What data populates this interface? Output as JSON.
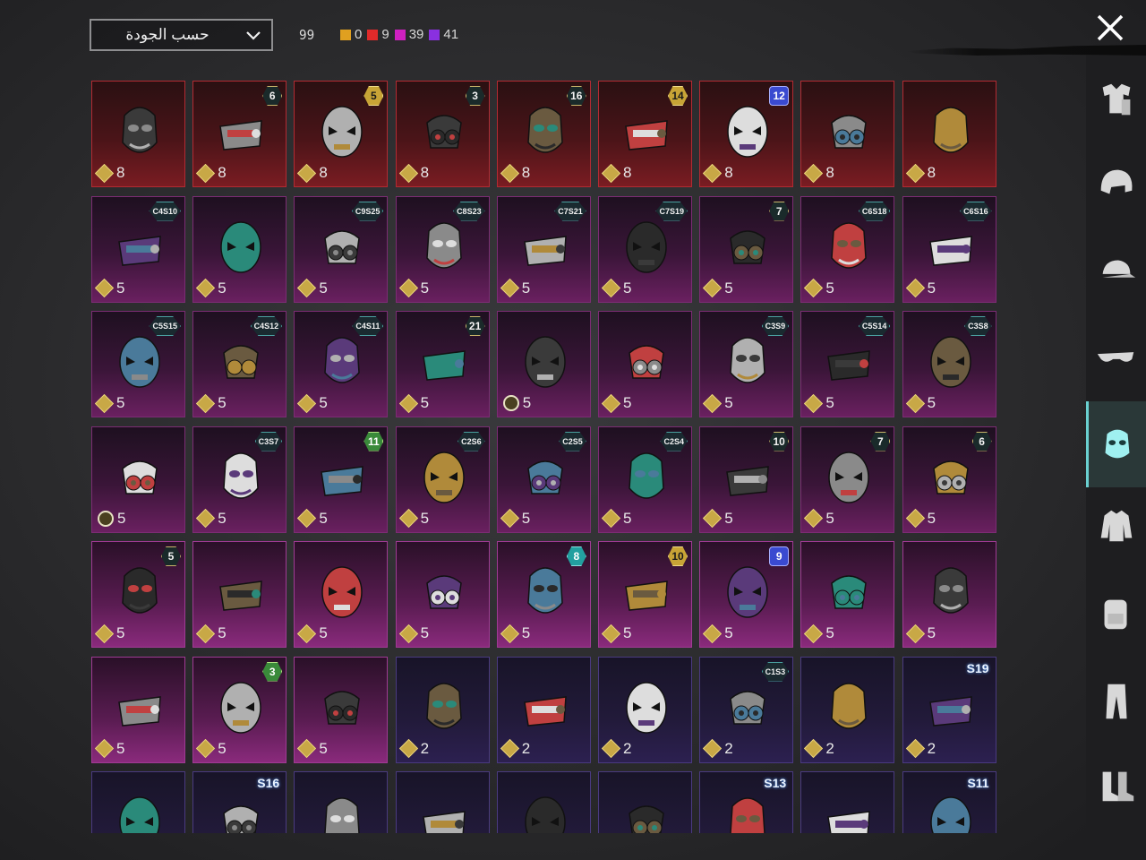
{
  "header": {
    "sort_label": "حسب الجودة",
    "total_count": "99",
    "quality_counts": [
      {
        "color": "#e0a020",
        "value": "0"
      },
      {
        "color": "#e02a2a",
        "value": "9"
      },
      {
        "color": "#d020c0",
        "value": "39"
      },
      {
        "color": "#8a30e0",
        "value": "41"
      }
    ],
    "close_icon": "close-icon"
  },
  "tiles": [
    {
      "rarity": "red",
      "count": "8",
      "badge": "",
      "badge_style": ""
    },
    {
      "rarity": "red",
      "count": "8",
      "badge": "6",
      "badge_style": ""
    },
    {
      "rarity": "red",
      "count": "8",
      "badge": "5",
      "badge_style": "gold"
    },
    {
      "rarity": "red",
      "count": "8",
      "badge": "3",
      "badge_style": ""
    },
    {
      "rarity": "red",
      "count": "8",
      "badge": "16",
      "badge_style": ""
    },
    {
      "rarity": "red",
      "count": "8",
      "badge": "14",
      "badge_style": "gold"
    },
    {
      "rarity": "red",
      "count": "8",
      "badge": "12",
      "badge_style": "blue-shield"
    },
    {
      "rarity": "red",
      "count": "8",
      "badge": "",
      "badge_style": ""
    },
    {
      "rarity": "red",
      "count": "8",
      "badge": "",
      "badge_style": ""
    },
    {
      "rarity": "pink",
      "count": "5",
      "badge": "C4S10",
      "badge_style": "hex-season"
    },
    {
      "rarity": "pink",
      "count": "5",
      "badge": "",
      "badge_style": ""
    },
    {
      "rarity": "pink",
      "count": "5",
      "badge": "C9S25",
      "badge_style": "hex-season"
    },
    {
      "rarity": "pink",
      "count": "5",
      "badge": "C8S23",
      "badge_style": "hex-season"
    },
    {
      "rarity": "pink",
      "count": "5",
      "badge": "C7S21",
      "badge_style": "hex-season"
    },
    {
      "rarity": "pink",
      "count": "5",
      "badge": "C7S19",
      "badge_style": "hex-season"
    },
    {
      "rarity": "pink",
      "count": "5",
      "badge": "7",
      "badge_style": ""
    },
    {
      "rarity": "pink",
      "count": "5",
      "badge": "C6S18",
      "badge_style": "hex-season"
    },
    {
      "rarity": "pink",
      "count": "5",
      "badge": "C6S16",
      "badge_style": "hex-season"
    },
    {
      "rarity": "pink",
      "count": "5",
      "badge": "C5S15",
      "badge_style": "hex-season"
    },
    {
      "rarity": "pink",
      "count": "5",
      "badge": "C4S12",
      "badge_style": "hex-season"
    },
    {
      "rarity": "pink",
      "count": "5",
      "badge": "C4S11",
      "badge_style": "hex-season"
    },
    {
      "rarity": "pink",
      "count": "5",
      "badge": "21",
      "badge_style": ""
    },
    {
      "rarity": "pink",
      "count": "5",
      "badge": "",
      "badge_style": "",
      "coin": "ring"
    },
    {
      "rarity": "pink",
      "count": "5",
      "badge": "",
      "badge_style": ""
    },
    {
      "rarity": "pink",
      "count": "5",
      "badge": "C3S9",
      "badge_style": "hex-season"
    },
    {
      "rarity": "pink",
      "count": "5",
      "badge": "C5S14",
      "badge_style": "hex-season"
    },
    {
      "rarity": "pink",
      "count": "5",
      "badge": "C3S8",
      "badge_style": "hex-season"
    },
    {
      "rarity": "pink",
      "count": "5",
      "badge": "",
      "badge_style": "",
      "coin": "ring"
    },
    {
      "rarity": "pink",
      "count": "5",
      "badge": "C3S7",
      "badge_style": "hex-season"
    },
    {
      "rarity": "pink",
      "count": "5",
      "badge": "11",
      "badge_style": "green"
    },
    {
      "rarity": "pink",
      "count": "5",
      "badge": "C2S6",
      "badge_style": "hex-season"
    },
    {
      "rarity": "pink",
      "count": "5",
      "badge": "C2S5",
      "badge_style": "hex-season"
    },
    {
      "rarity": "pink",
      "count": "5",
      "badge": "C2S4",
      "badge_style": "hex-season"
    },
    {
      "rarity": "pink",
      "count": "5",
      "badge": "10",
      "badge_style": ""
    },
    {
      "rarity": "pink",
      "count": "5",
      "badge": "7",
      "badge_style": ""
    },
    {
      "rarity": "pink",
      "count": "5",
      "badge": "6",
      "badge_style": ""
    },
    {
      "rarity": "pink bright",
      "count": "5",
      "badge": "5",
      "badge_style": ""
    },
    {
      "rarity": "pink bright",
      "count": "5",
      "badge": "",
      "badge_style": ""
    },
    {
      "rarity": "pink bright",
      "count": "5",
      "badge": "",
      "badge_style": ""
    },
    {
      "rarity": "pink bright",
      "count": "5",
      "badge": "",
      "badge_style": ""
    },
    {
      "rarity": "pink bright",
      "count": "5",
      "badge": "8",
      "badge_style": "teal"
    },
    {
      "rarity": "pink bright",
      "count": "5",
      "badge": "10",
      "badge_style": "gold"
    },
    {
      "rarity": "pink bright",
      "count": "5",
      "badge": "9",
      "badge_style": "blue-shield"
    },
    {
      "rarity": "pink bright",
      "count": "5",
      "badge": "",
      "badge_style": ""
    },
    {
      "rarity": "pink bright",
      "count": "5",
      "badge": "",
      "badge_style": ""
    },
    {
      "rarity": "pink bright",
      "count": "5",
      "badge": "",
      "badge_style": ""
    },
    {
      "rarity": "pink bright",
      "count": "5",
      "badge": "3",
      "badge_style": "green"
    },
    {
      "rarity": "pink bright",
      "count": "5",
      "badge": "",
      "badge_style": ""
    },
    {
      "rarity": "purple",
      "count": "2",
      "badge": "",
      "badge_style": ""
    },
    {
      "rarity": "purple",
      "count": "2",
      "badge": "",
      "badge_style": ""
    },
    {
      "rarity": "purple",
      "count": "2",
      "badge": "",
      "badge_style": ""
    },
    {
      "rarity": "purple",
      "count": "2",
      "badge": "C1S3",
      "badge_style": "hex-season"
    },
    {
      "rarity": "purple",
      "count": "2",
      "badge": "",
      "badge_style": ""
    },
    {
      "rarity": "purple",
      "count": "2",
      "badge": "S19",
      "badge_style": "ribbon"
    },
    {
      "rarity": "purple",
      "count": "",
      "badge": "",
      "badge_style": ""
    },
    {
      "rarity": "purple",
      "count": "",
      "badge": "S16",
      "badge_style": "ribbon"
    },
    {
      "rarity": "purple",
      "count": "",
      "badge": "",
      "badge_style": ""
    },
    {
      "rarity": "purple",
      "count": "",
      "badge": "",
      "badge_style": ""
    },
    {
      "rarity": "purple",
      "count": "",
      "badge": "",
      "badge_style": ""
    },
    {
      "rarity": "purple",
      "count": "",
      "badge": "",
      "badge_style": ""
    },
    {
      "rarity": "purple",
      "count": "",
      "badge": "S13",
      "badge_style": "ribbon"
    },
    {
      "rarity": "purple",
      "count": "",
      "badge": "",
      "badge_style": ""
    },
    {
      "rarity": "purple",
      "count": "",
      "badge": "S11",
      "badge_style": "ribbon"
    }
  ],
  "sidebar": [
    {
      "icon": "outfit-icon"
    },
    {
      "icon": "helmet-icon"
    },
    {
      "icon": "cap-icon"
    },
    {
      "icon": "glasses-icon"
    },
    {
      "icon": "mask-icon",
      "active": true
    },
    {
      "icon": "jacket-icon"
    },
    {
      "icon": "backpack-icon"
    },
    {
      "icon": "pants-icon"
    },
    {
      "icon": "boots-icon"
    }
  ]
}
